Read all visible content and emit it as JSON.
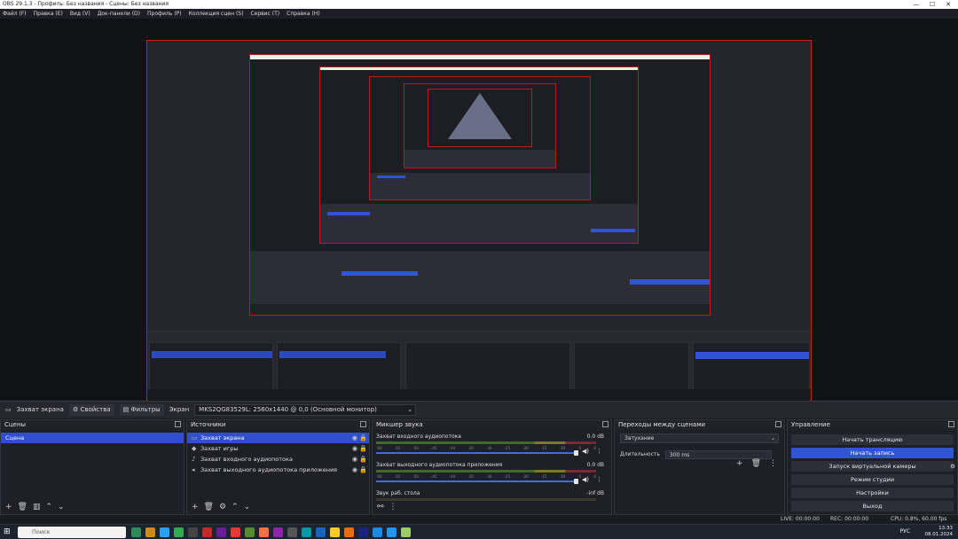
{
  "window": {
    "title": "OBS 29.1.3 - Профиль: Без названия - Сцены: Без названия",
    "min": "—",
    "max": "☐",
    "close": "✕"
  },
  "menu": [
    "Файл (F)",
    "Правка (E)",
    "Вид (V)",
    "Док-панели (D)",
    "Профиль (P)",
    "Коллекция сцен (S)",
    "Сервис (T)",
    "Справка (H)"
  ],
  "source_bar": {
    "source": "Захват экрана",
    "properties": "Свойства",
    "filters": "Фильтры",
    "screen_label": "Экран",
    "screen_value": "MKS2QG83529L: 2560x1440 @ 0,0 (Основной монитор)"
  },
  "scenes": {
    "title": "Сцены",
    "items": [
      "Сцена"
    ]
  },
  "sources": {
    "title": "Источники",
    "items": [
      {
        "icon": "monitor-icon",
        "label": "Захват экрана"
      },
      {
        "icon": "gamepad-icon",
        "label": "Захват игры"
      },
      {
        "icon": "mic-icon",
        "label": "Захват входного аудиопотока"
      },
      {
        "icon": "speaker-icon",
        "label": "Захват выходного аудиопотока приложения"
      }
    ]
  },
  "mixer": {
    "title": "Микшер звука",
    "channels": [
      {
        "name": "Захват входного аудиопотока",
        "db": "0.0 dB"
      },
      {
        "name": "Захват выходного аудиопотока приложения",
        "db": "0.0 dB"
      },
      {
        "name": "Звук раб. стола",
        "db": "-inf dB"
      }
    ],
    "ticks": [
      "-60",
      "-55",
      "-50",
      "-45",
      "-40",
      "-35",
      "-30",
      "-25",
      "-20",
      "-15",
      "-10",
      "-5",
      "0"
    ]
  },
  "transitions": {
    "title": "Переходы между сценами",
    "selected": "Затухание",
    "duration_label": "Длительность",
    "duration": "300 ms"
  },
  "controls": {
    "title": "Управление",
    "buttons": [
      "Начать трансляцию",
      "Начать запись",
      "Запуск виртуальной камеры",
      "Режим студии",
      "Настройки",
      "Выход"
    ]
  },
  "status": {
    "live": "LIVE: 00:00:00",
    "rec": "REC: 00:00:00",
    "cpu": "CPU: 0.8%, 60.00 fps"
  },
  "taskbar": {
    "search": "Поиск",
    "lang": "РУС",
    "time": "13:33",
    "date": "08.01.2024"
  },
  "colors": {
    "accent": "#2f55d4",
    "border_red": "#d01919"
  }
}
